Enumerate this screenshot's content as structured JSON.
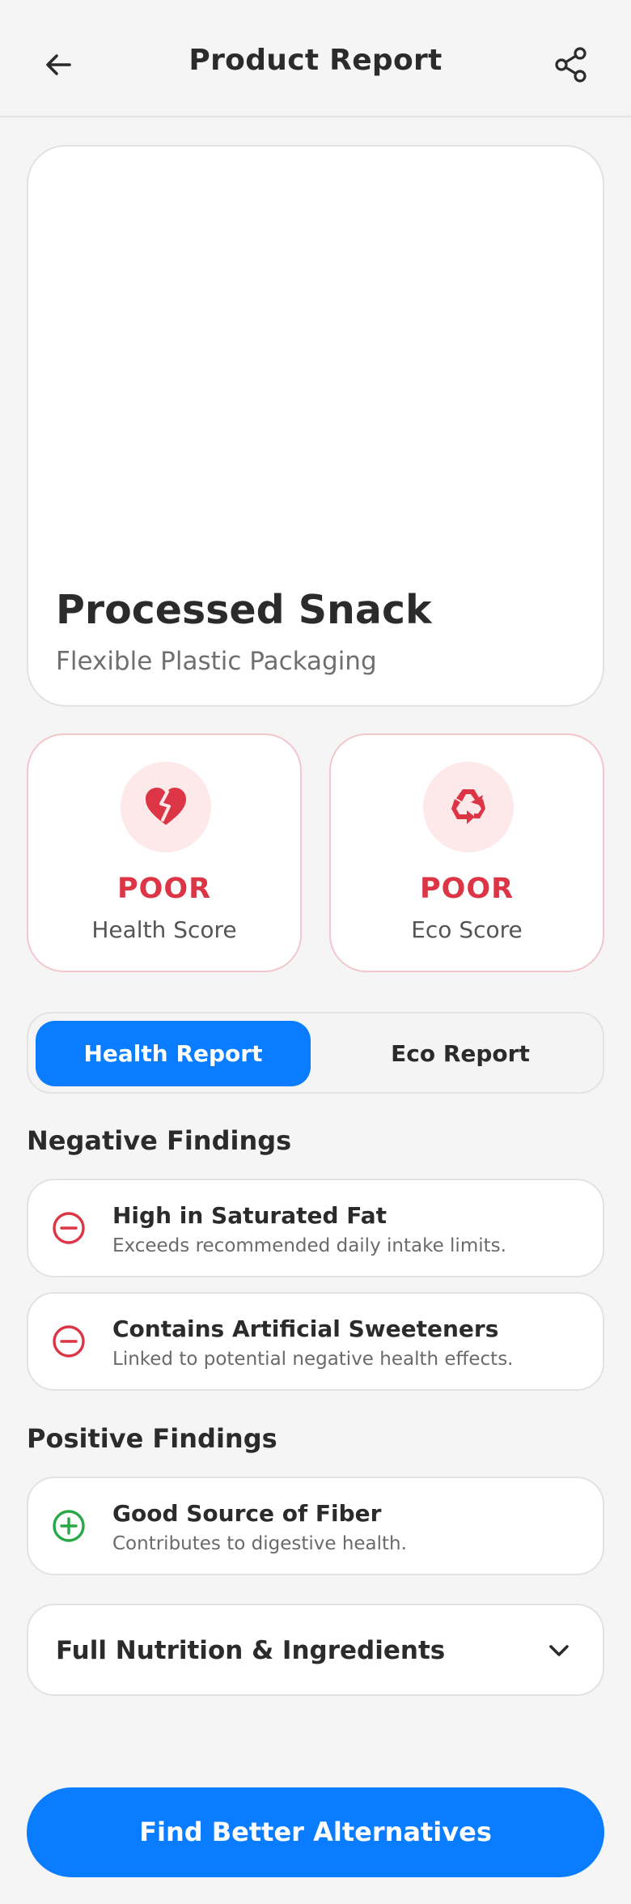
{
  "header": {
    "title": "Product Report",
    "back_icon": "arrow-left-icon",
    "share_icon": "share-icon"
  },
  "product": {
    "name": "Processed Snack",
    "packaging": "Flexible Plastic Packaging"
  },
  "scores": [
    {
      "rating": "POOR",
      "label": "Health Score",
      "icon": "broken-heart-icon"
    },
    {
      "rating": "POOR",
      "label": "Eco Score",
      "icon": "recycle-icon"
    }
  ],
  "tabs": {
    "health": "Health Report",
    "eco": "Eco Report",
    "active": "health"
  },
  "negative": {
    "title": "Negative Findings",
    "items": [
      {
        "title": "High in Saturated Fat",
        "desc": "Exceeds recommended daily intake limits.",
        "icon": "minus-circle-icon"
      },
      {
        "title": "Contains Artificial Sweeteners",
        "desc": "Linked to potential negative health effects.",
        "icon": "minus-circle-icon"
      }
    ]
  },
  "positive": {
    "title": "Positive Findings",
    "items": [
      {
        "title": "Good Source of Fiber",
        "desc": "Contributes to digestive health.",
        "icon": "plus-circle-icon"
      }
    ]
  },
  "accordion": {
    "title": "Full Nutrition & Ingredients",
    "icon": "chevron-down-icon"
  },
  "cta": {
    "label": "Find Better Alternatives"
  },
  "colors": {
    "accent": "#0a7cff",
    "poor": "#dc3545",
    "poor_bg": "#fde8ea",
    "positive": "#28a745",
    "background": "#f5f5f5"
  }
}
